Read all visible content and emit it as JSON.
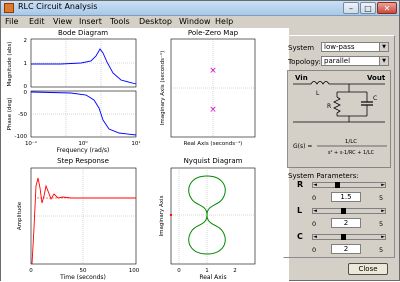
{
  "window": {
    "title": "RLC Circuit Analysis",
    "min": "–",
    "max": "□",
    "close": "✕"
  },
  "menu": [
    "File",
    "Edit",
    "View",
    "Insert",
    "Tools",
    "Desktop",
    "Window",
    "Help"
  ],
  "colors": {
    "trace_blue": "#0000ff",
    "trace_red": "#ff0000",
    "trace_green": "#008800",
    "pole_magenta": "#cc00cc",
    "background": "#d4d0c8"
  },
  "plots": {
    "bode": {
      "title": "Bode Diagram",
      "ylabel_mag": "Magnitude (abs)",
      "ylabel_phase": "Phase (deg)",
      "xlabel": "Frequency  (rad/s)",
      "mag_ticks": [
        "2",
        "1",
        "0"
      ],
      "phase_ticks": [
        "0",
        "-50",
        "-100"
      ],
      "x_ticks": [
        "10⁻¹",
        "10⁰",
        "10¹"
      ]
    },
    "pz": {
      "title": "Pole-Zero Map",
      "xlabel": "Real Axis (seconds⁻¹)",
      "ylabel": "Imaginary Axis (seconds⁻¹)",
      "pole_marker": "×"
    },
    "step": {
      "title": "Step Response",
      "xlabel": "Time (seconds)",
      "ylabel": "Amplitude",
      "x_ticks": [
        "0",
        "50",
        "100"
      ]
    },
    "nyquist": {
      "title": "Nyquist Diagram",
      "xlabel": "Real Axis",
      "ylabel": "Imaginary Axis",
      "x_ticks": [
        "0",
        "1",
        "2"
      ]
    }
  },
  "panel": {
    "system_label": "System",
    "system_value": "low-pass",
    "topology_label": "Topology:",
    "topology_value": "parallel",
    "circuit": {
      "vin": "Vin",
      "vout": "Vout",
      "L": "L",
      "R": "R",
      "C": "C",
      "gs_label": "G(s) =",
      "numerator": "1/LC",
      "denominator": "s² + s·1/RC + 1/LC"
    },
    "params_title": "System Parameters:",
    "params": [
      {
        "name": "R",
        "min": "0",
        "max": "5",
        "value": "1.5",
        "frac": 0.3
      },
      {
        "name": "L",
        "min": "0",
        "max": "5",
        "value": "2",
        "frac": 0.4
      },
      {
        "name": "C",
        "min": "0",
        "max": "5",
        "value": "2",
        "frac": 0.4
      }
    ]
  },
  "close_label": "Close"
}
